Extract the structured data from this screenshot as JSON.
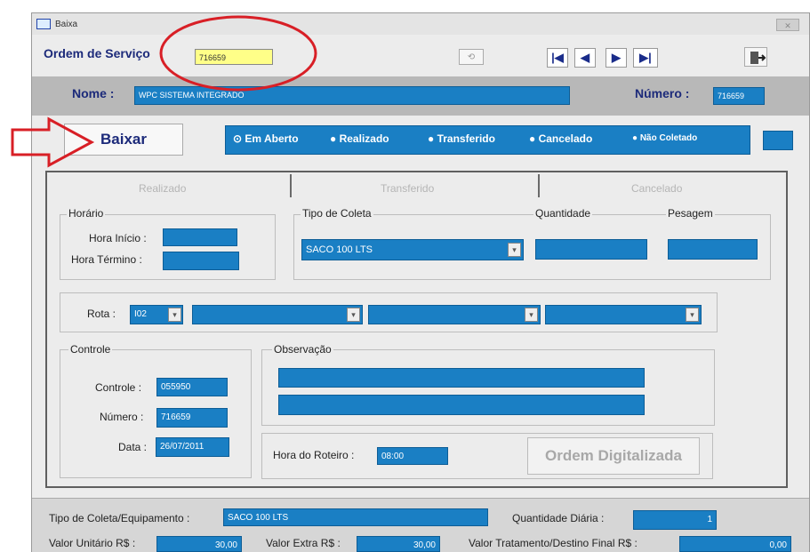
{
  "window": {
    "title": "Baixa"
  },
  "header": {
    "os_label": "Ordem de Serviço",
    "os_value": "716659",
    "undo_symbol": "⟲"
  },
  "nav": {
    "first": "|◀",
    "prev": "◀",
    "next": "▶",
    "last": "▶|"
  },
  "nome": {
    "label": "Nome :",
    "value": "WPC SISTEMA INTEGRADO"
  },
  "numero": {
    "label": "Número :",
    "value": "716659"
  },
  "baixar": {
    "label": "Baixar"
  },
  "status": {
    "options": [
      "Em Aberto",
      "Realizado",
      "Transferido",
      "Cancelado",
      "Não Coletado"
    ],
    "selected": "Em Aberto"
  },
  "tabs": [
    "Realizado",
    "Transferido",
    "Cancelado"
  ],
  "horario": {
    "title": "Horário",
    "inicio_label": "Hora Início :",
    "termino_label": "Hora Término :"
  },
  "coleta": {
    "title": "Tipo de Coleta",
    "tipo_value": "SACO 100 LTS",
    "quantidade_label": "Quantidade",
    "pesagem_label": "Pesagem"
  },
  "rota": {
    "label": "Rota :",
    "value": "I02"
  },
  "controle": {
    "title": "Controle",
    "controle_label": "Controle :",
    "controle_value": "055950",
    "numero_label": "Número :",
    "numero_value": "716659",
    "data_label": "Data :",
    "data_value": "26/07/2011"
  },
  "observacao": {
    "title": "Observação"
  },
  "roteiro": {
    "label": "Hora do Roteiro :",
    "value": "08:00"
  },
  "ordem_btn": {
    "label": "Ordem Digitalizada"
  },
  "footer": {
    "tipo_label": "Tipo de Coleta/Equipamento :",
    "tipo_value": "SACO 100 LTS",
    "qtd_label": "Quantidade Diária :",
    "qtd_value": "1",
    "unit_label": "Valor Unitário R$ :",
    "unit_value": "30,00",
    "extra_label": "Valor Extra R$ :",
    "extra_value": "30,00",
    "trat_label": "Valor Tratamento/Destino Final R$ :",
    "trat_value": "0,00"
  },
  "colors": {
    "field_blue": "#1a7fc4",
    "window_bg": "#ececec",
    "band_gray": "#b8b8b8",
    "highlight": "#ffff88",
    "annotation_red": "#d81f26"
  }
}
